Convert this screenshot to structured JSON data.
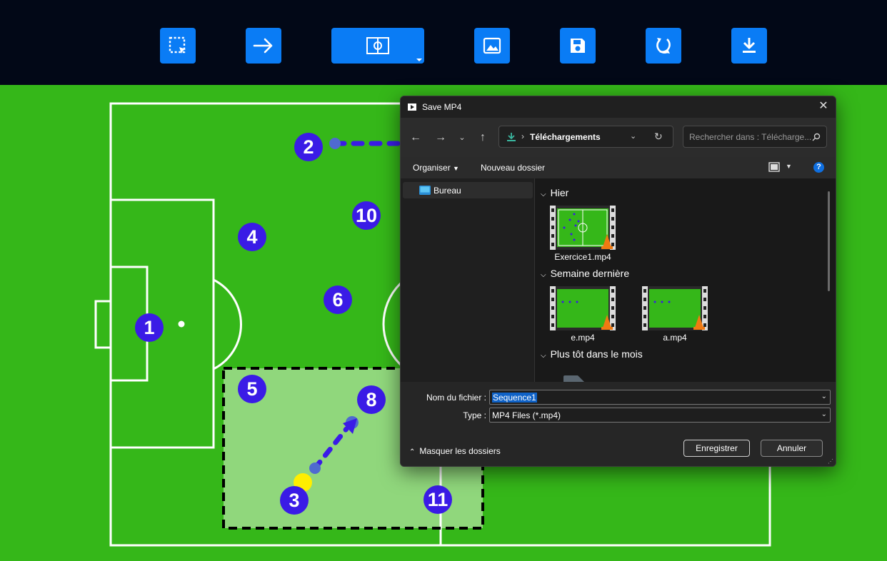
{
  "toolbar": {
    "buttons": [
      {
        "name": "select-area",
        "icon": "select-area-icon"
      },
      {
        "name": "arrow",
        "icon": "arrow-right-icon"
      },
      {
        "name": "field-view",
        "icon": "field-icon"
      },
      {
        "name": "image",
        "icon": "image-icon"
      },
      {
        "name": "save",
        "icon": "save-icon"
      },
      {
        "name": "reset",
        "icon": "refresh-icon"
      },
      {
        "name": "download",
        "icon": "download-icon"
      }
    ],
    "accent": "#0a7cf5",
    "background": "#020817"
  },
  "field": {
    "grass_color": "#35b719",
    "zone_color": "#90d77c",
    "player_color": "#3a1be6",
    "ball_color": "#ffee00",
    "players": [
      "1",
      "2",
      "3",
      "4",
      "5",
      "6",
      "8",
      "10",
      "11"
    ]
  },
  "dialog": {
    "title": "Save MP4",
    "breadcrumb": "Téléchargements",
    "search_placeholder": "Rechercher dans : Télécharge...",
    "commands": {
      "organise": "Organiser",
      "new_folder": "Nouveau dossier"
    },
    "nav_items": [
      "Bureau"
    ],
    "groups": [
      {
        "label": "Hier",
        "files": [
          "Exercice1.mp4"
        ]
      },
      {
        "label": "Semaine dernière",
        "files": [
          "e.mp4",
          "a.mp4"
        ]
      },
      {
        "label": "Plus tôt dans le mois",
        "files": []
      }
    ],
    "filename_label": "Nom du fichier :",
    "filename_value": "Sequence1",
    "type_label": "Type :",
    "type_value": "MP4 Files (*.mp4)",
    "hide_folders": "Masquer les dossiers",
    "save_button": "Enregistrer",
    "cancel_button": "Annuler"
  }
}
